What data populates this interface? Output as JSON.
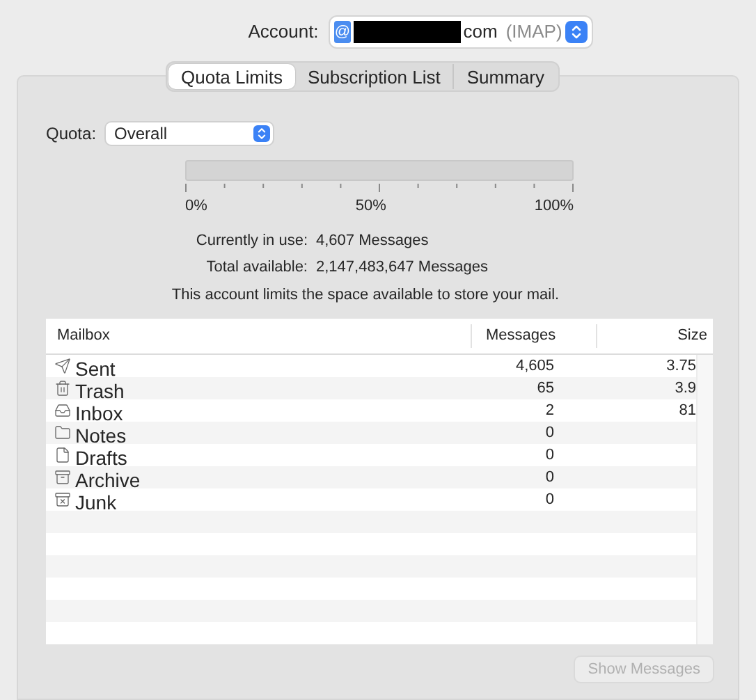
{
  "account": {
    "label": "Account:",
    "badge": "@",
    "domain": "com",
    "type": "(IMAP)"
  },
  "tabs": [
    {
      "label": "Quota Limits",
      "selected": true
    },
    {
      "label": "Subscription List",
      "selected": false
    },
    {
      "label": "Summary",
      "selected": false
    }
  ],
  "quota": {
    "label": "Quota:",
    "value": "Overall"
  },
  "usage_meter": {
    "level": 0,
    "tick_labels": [
      "0%",
      "50%",
      "100%"
    ]
  },
  "stats": [
    {
      "label": "Currently in use:",
      "value": "4,607 Messages"
    },
    {
      "label": "Total available:",
      "value": "2,147,483,647 Messages"
    }
  ],
  "note": "This account limits the space available to store your mail.",
  "table": {
    "columns": [
      "Mailbox",
      "Messages",
      "Size"
    ],
    "rows": [
      {
        "kind": "sent",
        "mailbox": "Sent",
        "messages": "4,605",
        "size": "3.75"
      },
      {
        "kind": "trash",
        "mailbox": "Trash",
        "messages": "65",
        "size": "3.9"
      },
      {
        "kind": "inbox",
        "mailbox": "Inbox",
        "messages": "2",
        "size": "81"
      },
      {
        "kind": "folder",
        "mailbox": "Notes",
        "messages": "0"
      },
      {
        "kind": "drafts",
        "mailbox": "Drafts",
        "messages": "0"
      },
      {
        "kind": "archive",
        "mailbox": "Archive",
        "messages": "0"
      },
      {
        "kind": "junk",
        "mailbox": "Junk",
        "messages": "0"
      }
    ]
  },
  "show_messages_button": {
    "label": "Show Messages",
    "disabled": true
  }
}
